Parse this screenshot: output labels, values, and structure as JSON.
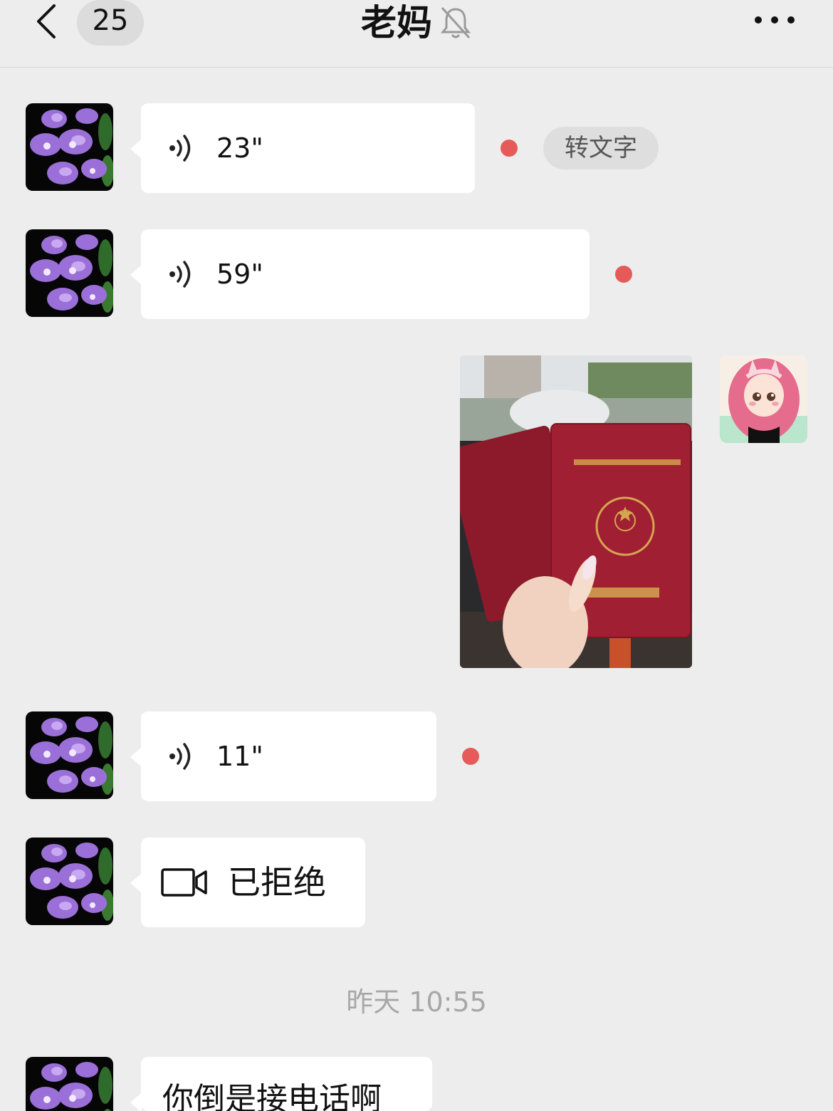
{
  "header": {
    "back_icon": "chevron-left-icon",
    "unread_count": "25",
    "title": "老妈",
    "mute_icon": "bell-slash-icon",
    "more_icon": "more-dots-icon"
  },
  "messages": [
    {
      "type": "voice",
      "sender": "contact",
      "duration": "23\"",
      "unread": true,
      "convert_label": "转文字"
    },
    {
      "type": "voice",
      "sender": "contact",
      "duration": "59\"",
      "unread": true
    },
    {
      "type": "image",
      "sender": "me",
      "description_icon": "photo-image"
    },
    {
      "type": "voice",
      "sender": "contact",
      "duration": "11\"",
      "unread": true
    },
    {
      "type": "video-call",
      "sender": "contact",
      "status": "已拒绝",
      "icon": "video-camera-icon"
    },
    {
      "type": "timestamp",
      "text": "昨天 10:55"
    },
    {
      "type": "text",
      "sender": "contact",
      "text": "你倒是接电话啊"
    }
  ],
  "colors": {
    "background": "#ededed",
    "bubble": "#ffffff",
    "unread_dot": "#e65a5a",
    "timestamp": "#a7a7a7"
  }
}
